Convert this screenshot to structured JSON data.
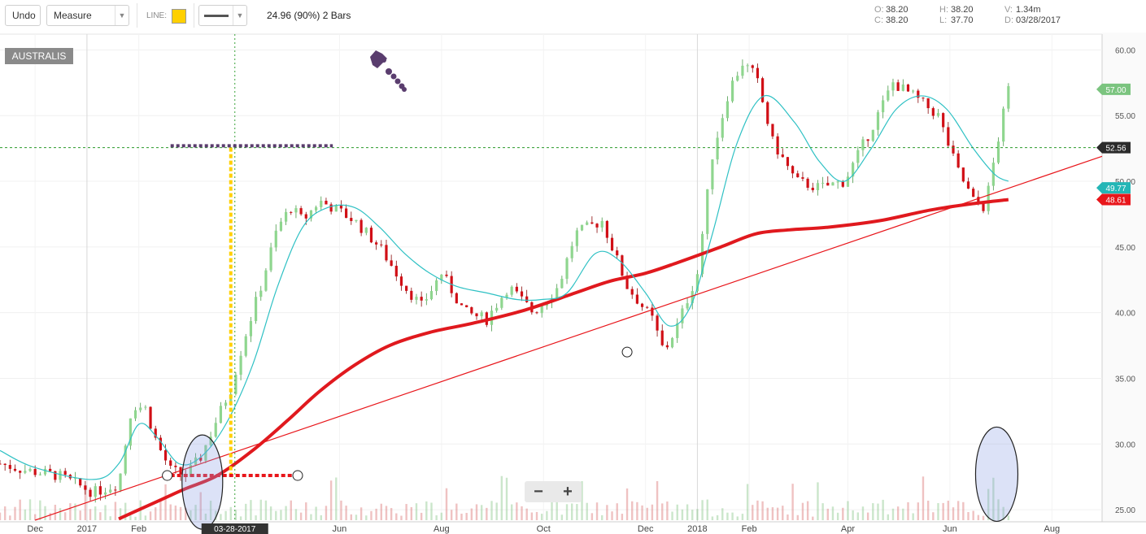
{
  "toolbar": {
    "undo_label": "Undo",
    "measure_label": "Measure",
    "line_label": "LINE:",
    "line_color": "#ffd000",
    "measure_result": "24.96 (90%) 2 Bars"
  },
  "ohlc": {
    "o_key": "O:",
    "o": "38.20",
    "c_key": "C:",
    "c": "38.20",
    "h_key": "H:",
    "h": "38.20",
    "l_key": "L:",
    "l": "37.70",
    "v_key": "V:",
    "v": "1.34m",
    "d_key": "D:",
    "d": "03/28/2017"
  },
  "chart_data": {
    "type": "candlestick",
    "symbol": "AUSTRALIS",
    "y_range": [
      24.2,
      61.2
    ],
    "y_ticks": [
      25,
      30,
      35,
      40,
      45,
      50,
      55,
      60
    ],
    "y_tick_labels": [
      "25.00",
      "30.00",
      "35.00",
      "40.00",
      "45.00",
      "50.00",
      "55.00",
      "60.00"
    ],
    "x_range": [
      "2016-11-10",
      "2018-08-31"
    ],
    "x_ticks": [
      {
        "date": "2016-12-01",
        "label": "Dec"
      },
      {
        "date": "2017-01-01",
        "label": "2017"
      },
      {
        "date": "2017-02-01",
        "label": "Feb"
      },
      {
        "date": "2017-06-01",
        "label": "Jun"
      },
      {
        "date": "2017-08-01",
        "label": "Aug"
      },
      {
        "date": "2017-10-01",
        "label": "Oct"
      },
      {
        "date": "2017-12-01",
        "label": "Dec"
      },
      {
        "date": "2018-01-01",
        "label": "2018"
      },
      {
        "date": "2018-02-01",
        "label": "Feb"
      },
      {
        "date": "2018-04-01",
        "label": "Apr"
      },
      {
        "date": "2018-06-01",
        "label": "Jun"
      },
      {
        "date": "2018-08-01",
        "label": "Aug"
      }
    ],
    "close_path": [
      [
        "2016-11-10",
        28.5
      ],
      [
        "2016-11-25",
        28.0
      ],
      [
        "2016-12-15",
        27.6
      ],
      [
        "2017-01-05",
        26.3
      ],
      [
        "2017-01-20",
        27.0
      ],
      [
        "2017-01-28",
        33.0
      ],
      [
        "2017-02-05",
        32.7
      ],
      [
        "2017-02-12",
        30.0
      ],
      [
        "2017-02-20",
        28.0
      ],
      [
        "2017-03-01",
        27.6
      ],
      [
        "2017-03-10",
        29.0
      ],
      [
        "2017-03-20",
        32.0
      ],
      [
        "2017-03-28",
        34.2
      ],
      [
        "2017-04-05",
        38.0
      ],
      [
        "2017-04-15",
        42.0
      ],
      [
        "2017-04-25",
        46.5
      ],
      [
        "2017-05-03",
        48.0
      ],
      [
        "2017-05-10",
        47.0
      ],
      [
        "2017-05-20",
        48.5
      ],
      [
        "2017-05-28",
        48.0
      ],
      [
        "2017-06-10",
        47.0
      ],
      [
        "2017-06-25",
        45.0
      ],
      [
        "2017-07-10",
        42.0
      ],
      [
        "2017-07-20",
        40.5
      ],
      [
        "2017-08-01",
        43.0
      ],
      [
        "2017-08-15",
        40.0
      ],
      [
        "2017-08-28",
        39.5
      ],
      [
        "2017-09-10",
        42.0
      ],
      [
        "2017-09-25",
        40.0
      ],
      [
        "2017-10-10",
        42.0
      ],
      [
        "2017-10-20",
        46.0
      ],
      [
        "2017-11-05",
        47.0
      ],
      [
        "2017-11-20",
        42.0
      ],
      [
        "2017-12-05",
        39.5
      ],
      [
        "2017-12-12",
        37.0
      ],
      [
        "2017-12-20",
        39.0
      ],
      [
        "2018-01-01",
        43.0
      ],
      [
        "2018-01-10",
        52.0
      ],
      [
        "2018-01-20",
        57.0
      ],
      [
        "2018-01-28",
        59.0
      ],
      [
        "2018-02-05",
        58.0
      ],
      [
        "2018-02-15",
        53.0
      ],
      [
        "2018-03-01",
        50.0
      ],
      [
        "2018-03-15",
        49.5
      ],
      [
        "2018-03-30",
        50.0
      ],
      [
        "2018-04-15",
        54.0
      ],
      [
        "2018-04-28",
        57.5
      ],
      [
        "2018-05-10",
        56.5
      ],
      [
        "2018-05-25",
        55.0
      ],
      [
        "2018-06-05",
        51.0
      ],
      [
        "2018-06-15",
        48.5
      ],
      [
        "2018-06-22",
        48.0
      ],
      [
        "2018-06-28",
        52.0
      ],
      [
        "2018-07-06",
        57.0
      ]
    ],
    "teal_ma": [
      [
        "2016-11-10",
        29.5
      ],
      [
        "2016-12-01",
        28.2
      ],
      [
        "2017-01-05",
        27.3
      ],
      [
        "2017-01-20",
        28.5
      ],
      [
        "2017-02-01",
        31.5
      ],
      [
        "2017-02-12",
        30.5
      ],
      [
        "2017-02-25",
        28.5
      ],
      [
        "2017-03-10",
        29.0
      ],
      [
        "2017-03-25",
        31.5
      ],
      [
        "2017-04-10",
        36.0
      ],
      [
        "2017-04-25",
        42.0
      ],
      [
        "2017-05-10",
        46.5
      ],
      [
        "2017-05-25",
        48.0
      ],
      [
        "2017-06-10",
        48.0
      ],
      [
        "2017-06-25",
        46.5
      ],
      [
        "2017-07-10",
        44.5
      ],
      [
        "2017-07-25",
        43.0
      ],
      [
        "2017-08-10",
        42.0
      ],
      [
        "2017-08-28",
        41.5
      ],
      [
        "2017-09-15",
        41.0
      ],
      [
        "2017-09-30",
        41.0
      ],
      [
        "2017-10-15",
        41.5
      ],
      [
        "2017-11-01",
        44.5
      ],
      [
        "2017-11-15",
        44.0
      ],
      [
        "2017-12-01",
        41.5
      ],
      [
        "2017-12-15",
        39.0
      ],
      [
        "2017-12-28",
        40.5
      ],
      [
        "2018-01-10",
        46.0
      ],
      [
        "2018-01-25",
        53.0
      ],
      [
        "2018-02-10",
        56.5
      ],
      [
        "2018-02-28",
        54.5
      ],
      [
        "2018-03-15",
        51.5
      ],
      [
        "2018-03-30",
        50.0
      ],
      [
        "2018-04-15",
        52.5
      ],
      [
        "2018-04-30",
        55.5
      ],
      [
        "2018-05-15",
        56.5
      ],
      [
        "2018-05-30",
        55.5
      ],
      [
        "2018-06-15",
        52.5
      ],
      [
        "2018-06-28",
        50.5
      ],
      [
        "2018-07-06",
        50.0
      ]
    ],
    "red_ma": [
      [
        "2017-01-20",
        24.3
      ],
      [
        "2017-02-15",
        25.8
      ],
      [
        "2017-03-01",
        26.6
      ],
      [
        "2017-03-20",
        27.6
      ],
      [
        "2017-04-10",
        29.5
      ],
      [
        "2017-05-01",
        31.8
      ],
      [
        "2017-05-20",
        34.0
      ],
      [
        "2017-06-10",
        36.0
      ],
      [
        "2017-07-01",
        37.5
      ],
      [
        "2017-07-25",
        38.5
      ],
      [
        "2017-08-20",
        39.2
      ],
      [
        "2017-09-20",
        40.2
      ],
      [
        "2017-10-20",
        41.5
      ],
      [
        "2017-11-10",
        42.4
      ],
      [
        "2017-12-01",
        43.0
      ],
      [
        "2017-12-20",
        43.8
      ],
      [
        "2018-01-15",
        45.0
      ],
      [
        "2018-02-05",
        46.0
      ],
      [
        "2018-02-25",
        46.3
      ],
      [
        "2018-03-20",
        46.5
      ],
      [
        "2018-04-20",
        47.0
      ],
      [
        "2018-05-20",
        47.8
      ],
      [
        "2018-06-15",
        48.3
      ],
      [
        "2018-07-06",
        48.6
      ]
    ],
    "trendline": {
      "from": [
        "2016-12-01",
        24.2
      ],
      "to": [
        "2018-08-31",
        51.9
      ],
      "color": "#e8161b"
    },
    "h_line": {
      "value": 52.56,
      "label": "52.56"
    },
    "price_tags": [
      {
        "label": "57.00",
        "value": 57.0,
        "color": "#7bc47f"
      },
      {
        "label": "49.77",
        "value": 49.5,
        "color": "#24b6b6"
      },
      {
        "label": "48.61",
        "value": 48.61,
        "color": "#e8161b"
      }
    ],
    "measure_vertical_date": "2017-03-28",
    "cursor_date_label": "03-28-2017"
  }
}
